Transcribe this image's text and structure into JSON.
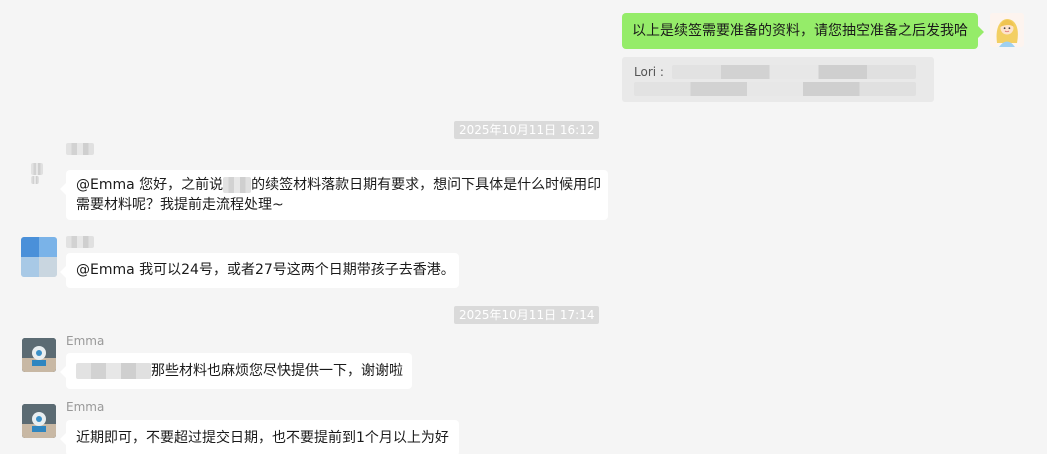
{
  "messages": {
    "m1": {
      "text": "以上是续签需要准备的资料，请您抽空准备之后发我哈"
    },
    "quote1": {
      "label": "Lori :"
    },
    "ts1": "2025年10月11日 16:12",
    "m2": {
      "mention": "@Emma 您好，之前说",
      "after_redact": "的续签材料落款日期有要求，想问下具体是什么时候用印",
      "line2": "需要材料呢？我提前走流程处理~"
    },
    "m3": {
      "text": "@Emma 我可以24号，或者27号这两个日期带孩子去香港。"
    },
    "ts2": "2025年10月11日 17:14",
    "m4": {
      "sender": "Emma",
      "text": "那些材料也麻烦您尽快提供一下，谢谢啦"
    },
    "m5": {
      "sender": "Emma",
      "text": "近期即可，不要超过提交日期，也不要提前到1个月以上为好"
    }
  },
  "colors": {
    "background": "#f5f5f5",
    "self_bubble": "#95ec69",
    "other_bubble": "#ffffff",
    "timestamp_bg": "#dadada"
  }
}
